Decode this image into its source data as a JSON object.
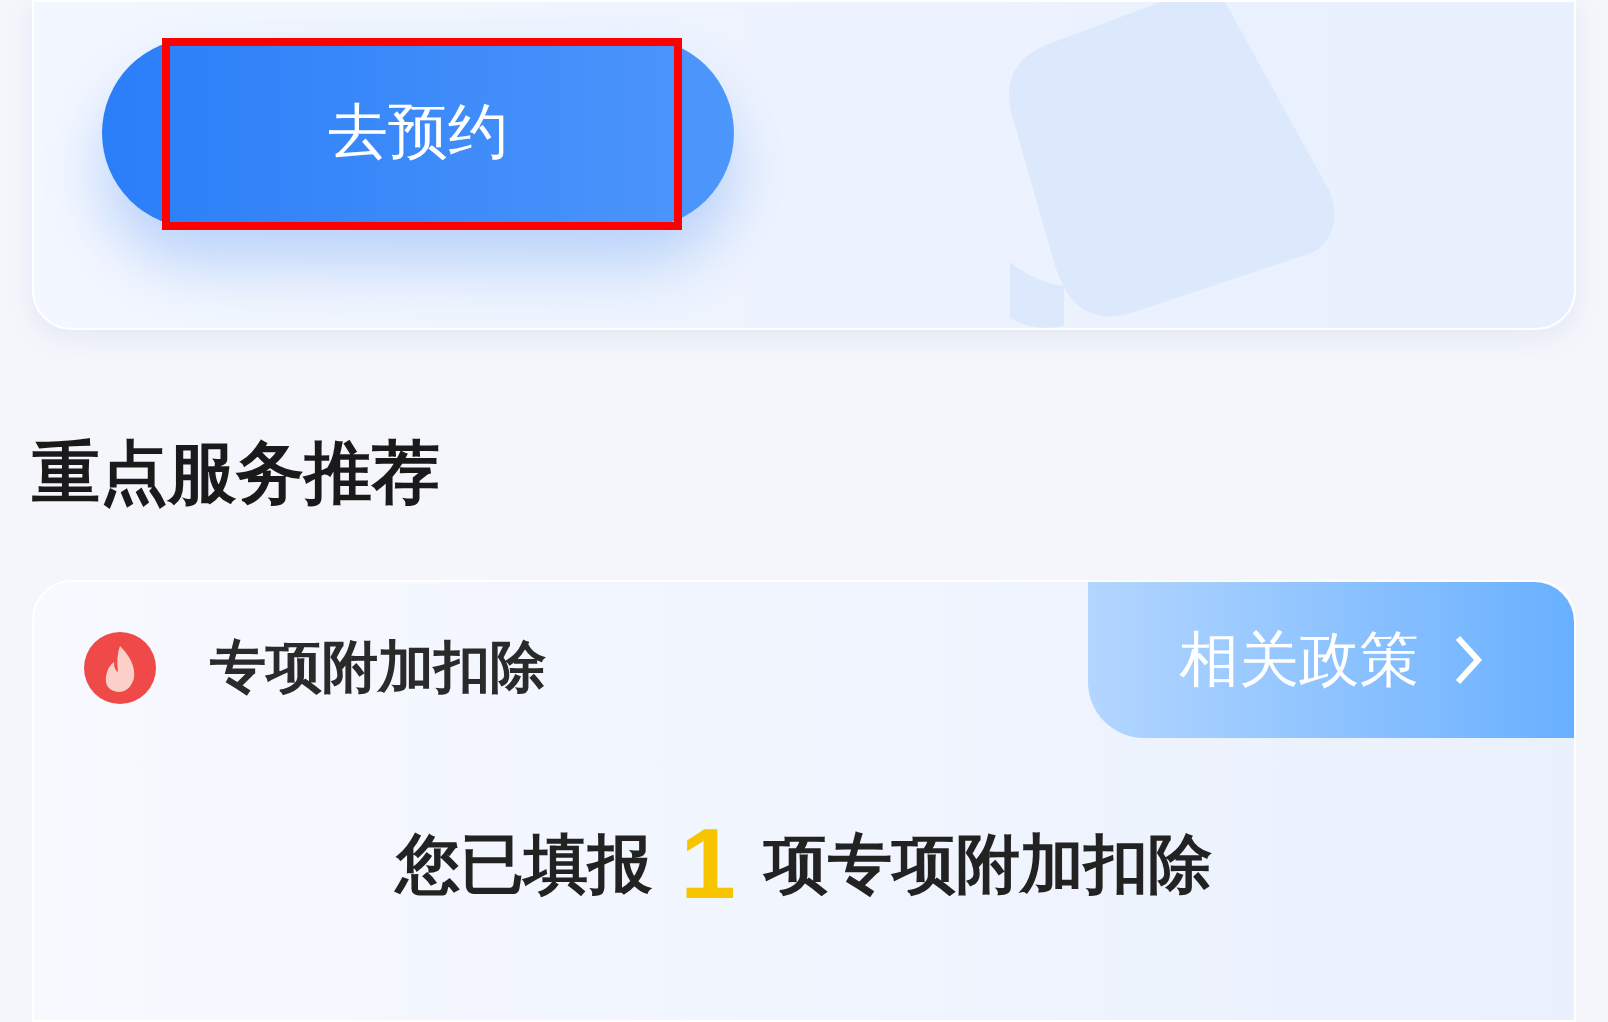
{
  "booking_card": {
    "button": "去预约"
  },
  "section_title": "重点服务推荐",
  "service_card": {
    "title": "专项附加扣除",
    "policy_link": "相关政策",
    "summary": {
      "prefix": "您已填报",
      "count": "1",
      "suffix": "项专项附加扣除"
    }
  }
}
